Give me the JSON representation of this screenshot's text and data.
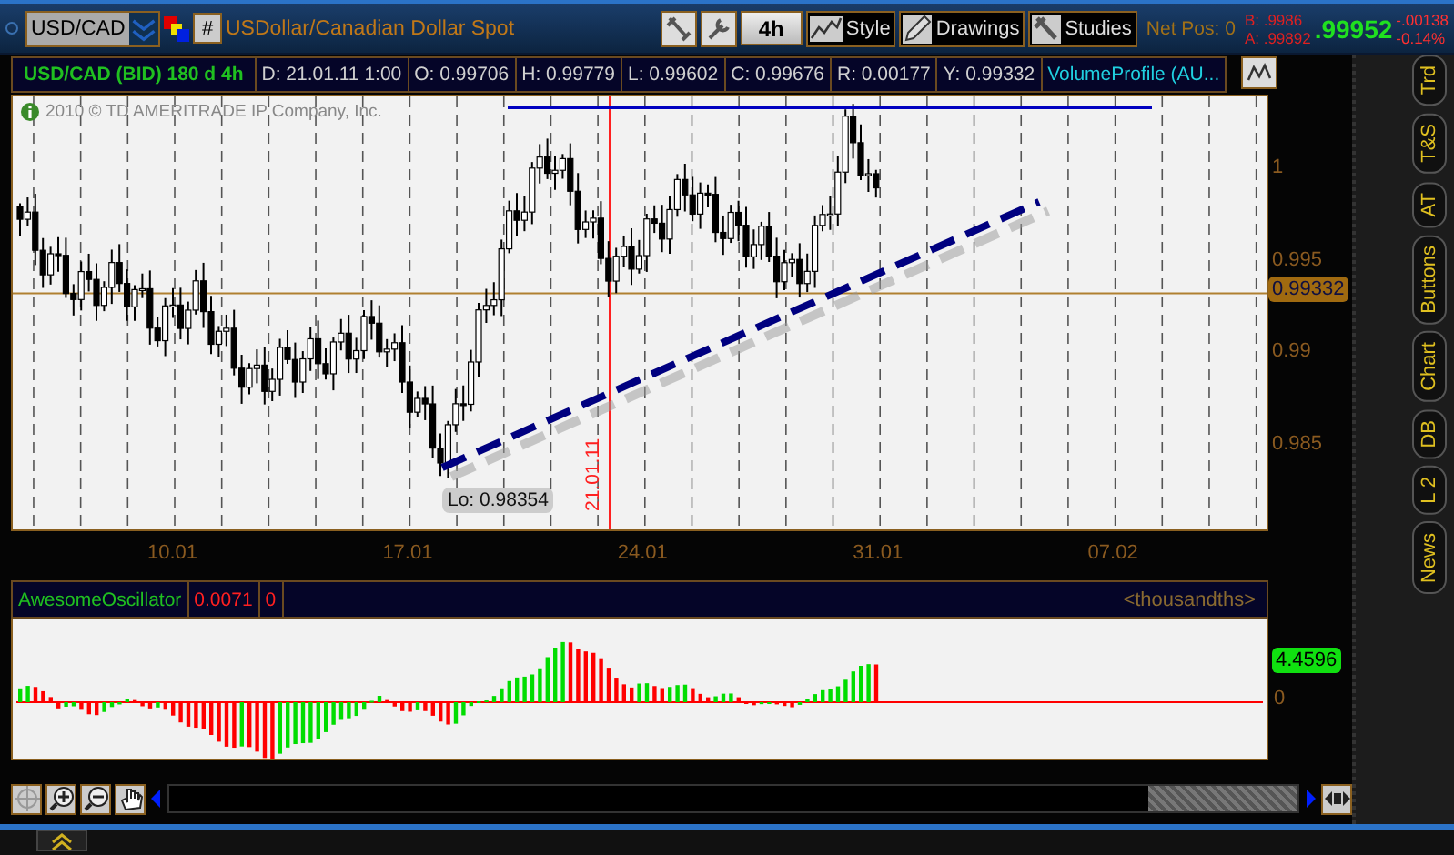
{
  "toolbar": {
    "symbol": "USD/CAD",
    "hash_button": "#",
    "description": "USDollar/Canadian Dollar Spot",
    "aggregation": "4h",
    "buttons": [
      {
        "label": "Style",
        "kind": "style"
      },
      {
        "label": "Drawings",
        "kind": "drawings"
      },
      {
        "label": "Studies",
        "kind": "studies"
      }
    ],
    "net_position": "Net Pos: 0",
    "bid": "B: .9986",
    "ask": "A: .99892",
    "last": ".99952",
    "change": "-.00138",
    "change_percent": "-0.14%"
  },
  "info_bar": {
    "title": "USD/CAD (BID) 180 d 4h",
    "fields": [
      "D: 21.01.11 1:00",
      "O: 0.99706",
      "H: 0.99779",
      "L: 0.99602",
      "C: 0.99676",
      "R: 0.00177",
      "Y: 0.99332"
    ],
    "study": "VolumeProfile (AU..."
  },
  "price_chart": {
    "copyright": "2010 © TD AMERITRADE IP Company, Inc.",
    "price_labels": [
      "1",
      "0.995",
      "0.99",
      "0.985"
    ],
    "last_price_tag": "0.99332",
    "low_label": "Lo: 0.98354",
    "cursor_date": "21.01.11",
    "date_labels": [
      "10.01",
      "17.01",
      "24.01",
      "31.01",
      "07.02"
    ]
  },
  "oscillator": {
    "name": "AwesomeOscillator",
    "value": "0.0071",
    "value_2": "0",
    "units": "<thousandths>",
    "current_tag": "4.4596",
    "zero_label": "0"
  },
  "side_tabs": [
    "Trd",
    "T&S",
    "AT",
    "Buttons",
    "Chart",
    "DB",
    "L 2",
    "News"
  ]
}
